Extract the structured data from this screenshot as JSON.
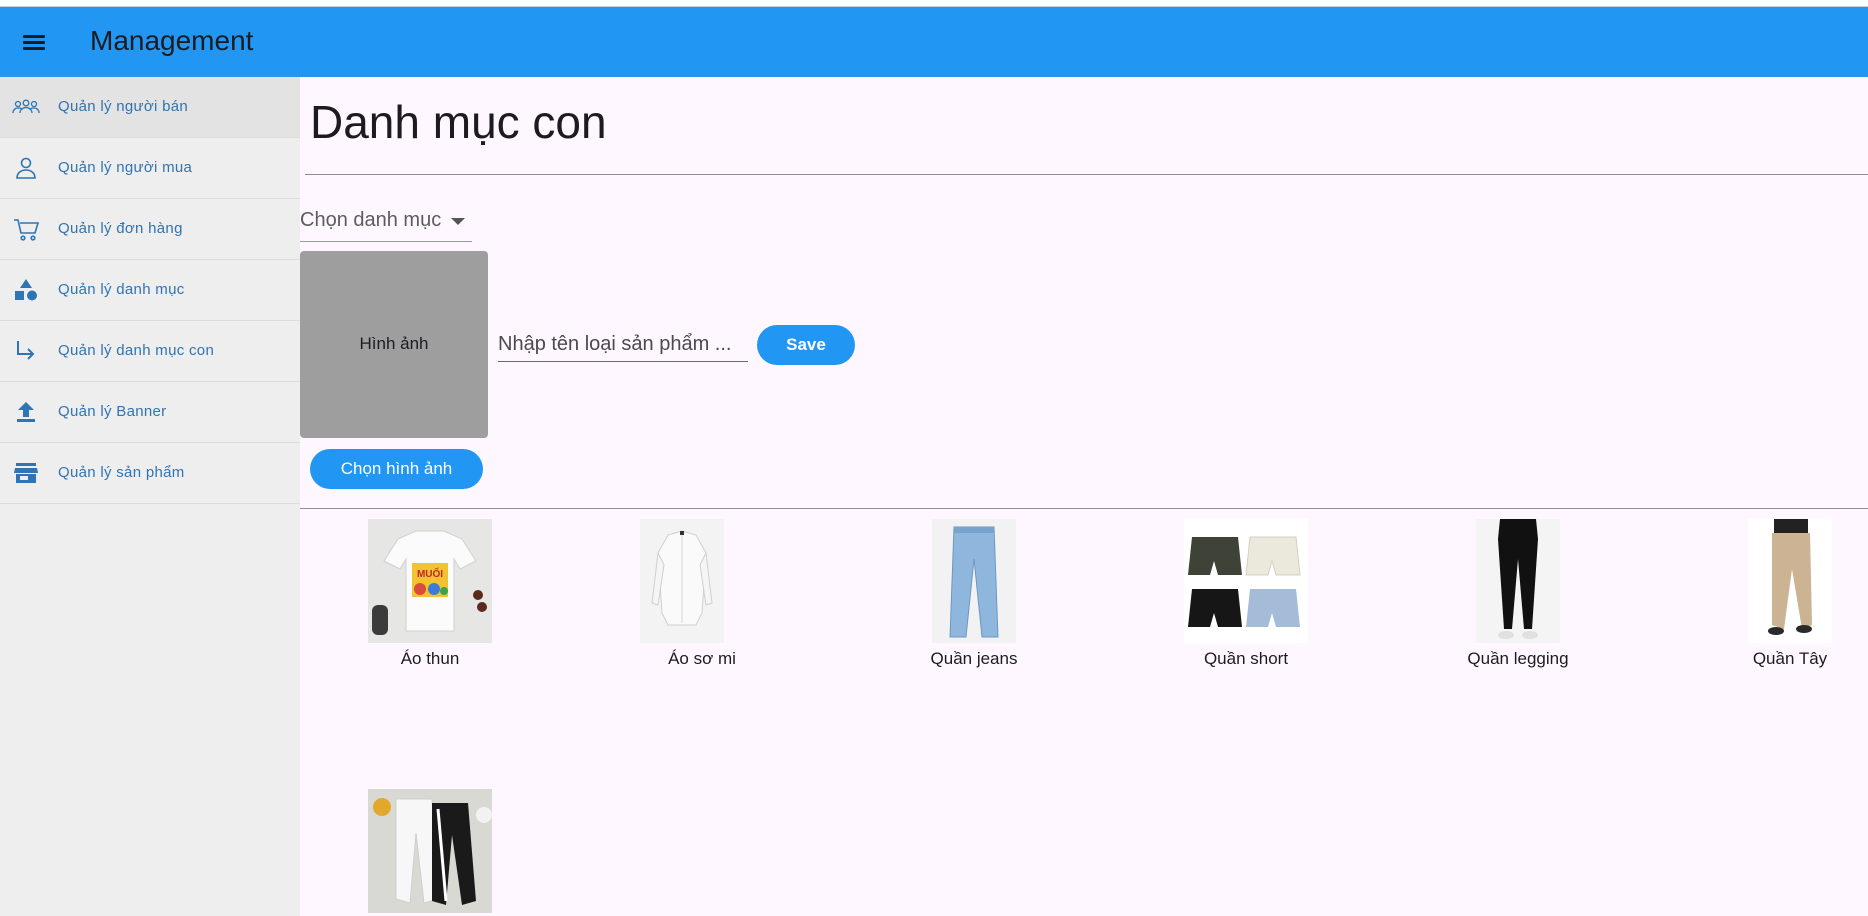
{
  "app": {
    "title": "Management"
  },
  "sidebar": {
    "items": [
      {
        "label": "Quản lý người bán",
        "icon": "group-icon",
        "active": true
      },
      {
        "label": "Quản lý người mua",
        "icon": "person-icon"
      },
      {
        "label": "Quản lý đơn hàng",
        "icon": "cart-icon"
      },
      {
        "label": "Quản lý danh mục",
        "icon": "category-shapes-icon"
      },
      {
        "label": "Quản lý danh mục con",
        "icon": "subdirectory-arrow-icon"
      },
      {
        "label": "Quản lý Banner",
        "icon": "upload-icon"
      },
      {
        "label": "Quản lý sản phẩm",
        "icon": "store-icon"
      }
    ]
  },
  "main": {
    "title": "Danh mục con",
    "dropdown": {
      "value": "Chọn danh mục"
    },
    "image_box": {
      "label": "Hình ảnh"
    },
    "name_input": {
      "placeholder": "Nhập tên loại sản phẩm ..."
    },
    "save_label": "Save",
    "choose_image_label": "Chọn hình ảnh",
    "categories": [
      {
        "name": "Áo thun",
        "icon": "tshirt-image"
      },
      {
        "name": "Áo sơ mi",
        "icon": "shirt-image"
      },
      {
        "name": "Quần jeans",
        "icon": "jeans-image"
      },
      {
        "name": "Quần short",
        "icon": "shorts-image"
      },
      {
        "name": "Quần legging",
        "icon": "legging-image"
      },
      {
        "name": "Quần Tây",
        "icon": "trousers-image"
      },
      {
        "name": "",
        "icon": "joggers-image"
      }
    ]
  },
  "colors": {
    "primary": "#2196f3",
    "sidebar_bg": "#eeeeee",
    "sidebar_text": "#2f74b3",
    "main_bg": "#fef7ff",
    "image_box": "#9e9e9e"
  }
}
